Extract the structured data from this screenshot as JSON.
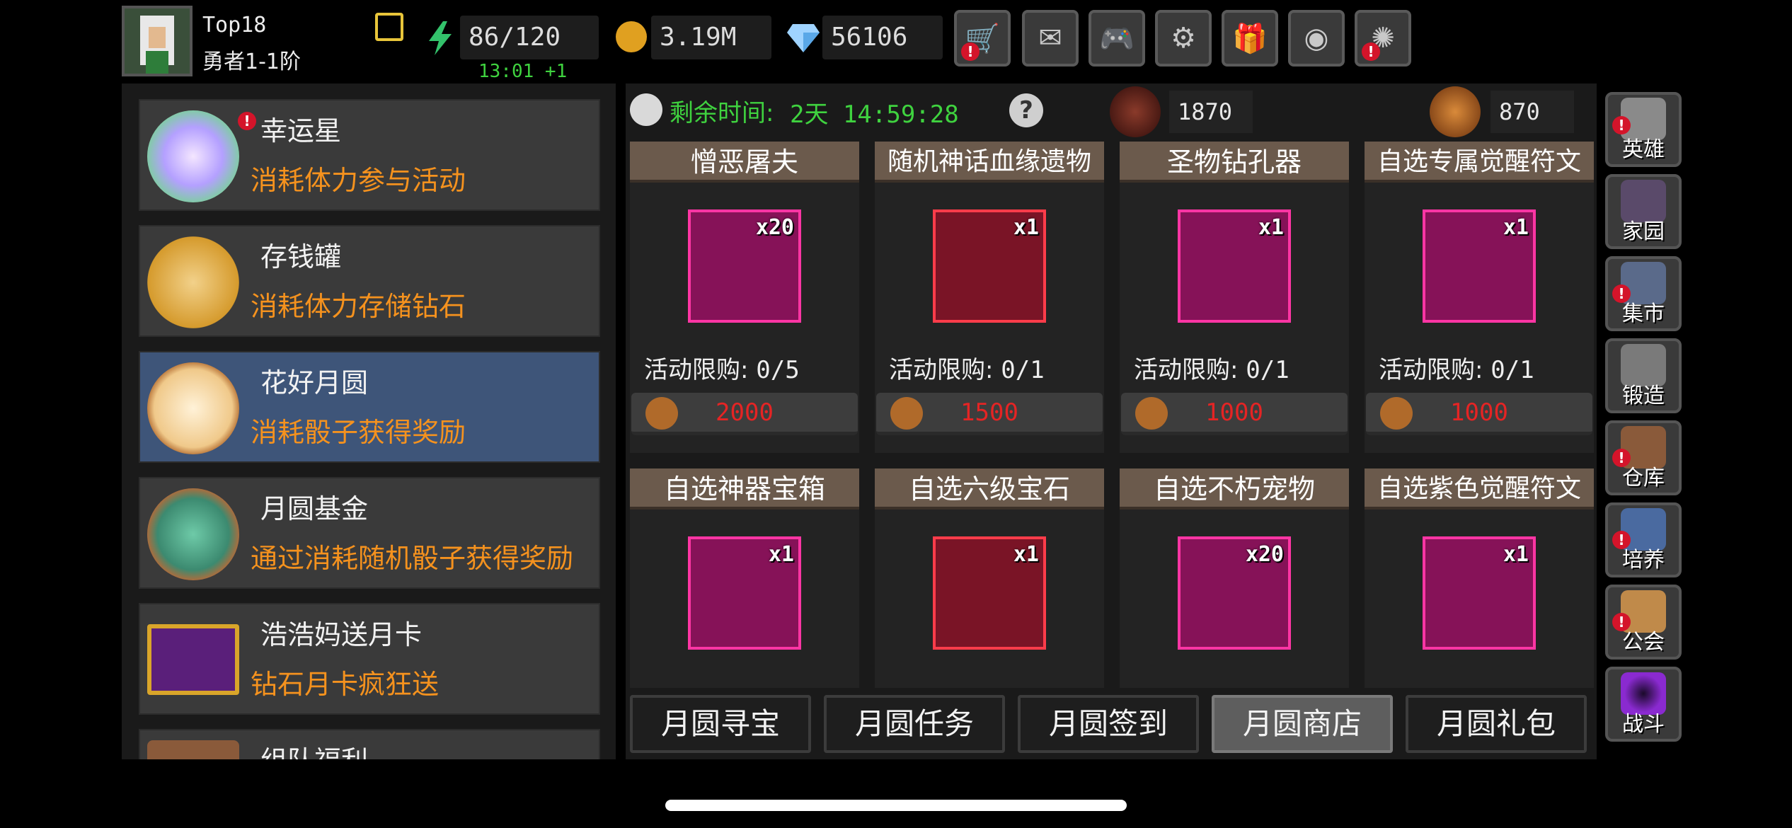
{
  "player": {
    "name": "Top18",
    "rank": "勇者1-1阶"
  },
  "resources": {
    "stamina": "86/120",
    "stamina_timer": "13:01 +1",
    "gold": "3.19M",
    "diamonds": "56106"
  },
  "events": [
    {
      "title": "幸运星",
      "desc": "消耗体力参与活动",
      "alert": "!"
    },
    {
      "title": "存钱罐",
      "desc": "消耗体力存储钻石"
    },
    {
      "title": "花好月圆",
      "desc": "消耗骰子获得奖励"
    },
    {
      "title": "月圆基金",
      "desc": "通过消耗随机骰子获得奖励"
    },
    {
      "title": "浩浩妈送月卡",
      "desc": "钻石月卡疯狂送"
    },
    {
      "title": "组队福利"
    }
  ],
  "shop": {
    "remaining_label": "剩余时间:",
    "remaining_value": "2天 14:59:28",
    "currency_a": "1870",
    "currency_b": "870",
    "cards": [
      {
        "name": "憎恶屠夫",
        "qty": "x20",
        "limit_label": "活动限购:",
        "limit": "0/5",
        "price": "2000"
      },
      {
        "name": "随机神话血缘遗物",
        "qty": "x1",
        "limit_label": "活动限购:",
        "limit": "0/1",
        "price": "1500"
      },
      {
        "name": "圣物钻孔器",
        "qty": "x1",
        "limit_label": "活动限购:",
        "limit": "0/1",
        "price": "1000"
      },
      {
        "name": "自选专属觉醒符文",
        "qty": "x1",
        "limit_label": "活动限购:",
        "limit": "0/1",
        "price": "1000"
      },
      {
        "name": "自选神器宝箱",
        "qty": "x1"
      },
      {
        "name": "自选六级宝石",
        "qty": "x1"
      },
      {
        "name": "自选不朽宠物",
        "qty": "x20"
      },
      {
        "name": "自选紫色觉醒符文",
        "qty": "x1"
      }
    ],
    "tabs": [
      "月圆寻宝",
      "月圆任务",
      "月圆签到",
      "月圆商店",
      "月圆礼包"
    ]
  },
  "sidebar": [
    {
      "label": "英雄"
    },
    {
      "label": "家园"
    },
    {
      "label": "集市"
    },
    {
      "label": "锻造"
    },
    {
      "label": "仓库"
    },
    {
      "label": "培养"
    },
    {
      "label": "公会"
    },
    {
      "label": "战斗"
    }
  ],
  "colors": {
    "accent_orange": "#f5921e",
    "timer_green": "#3fd23f",
    "price_red": "#e52424",
    "selected_event": "#3e5579",
    "item_frame_magenta": "#ff35a4"
  }
}
